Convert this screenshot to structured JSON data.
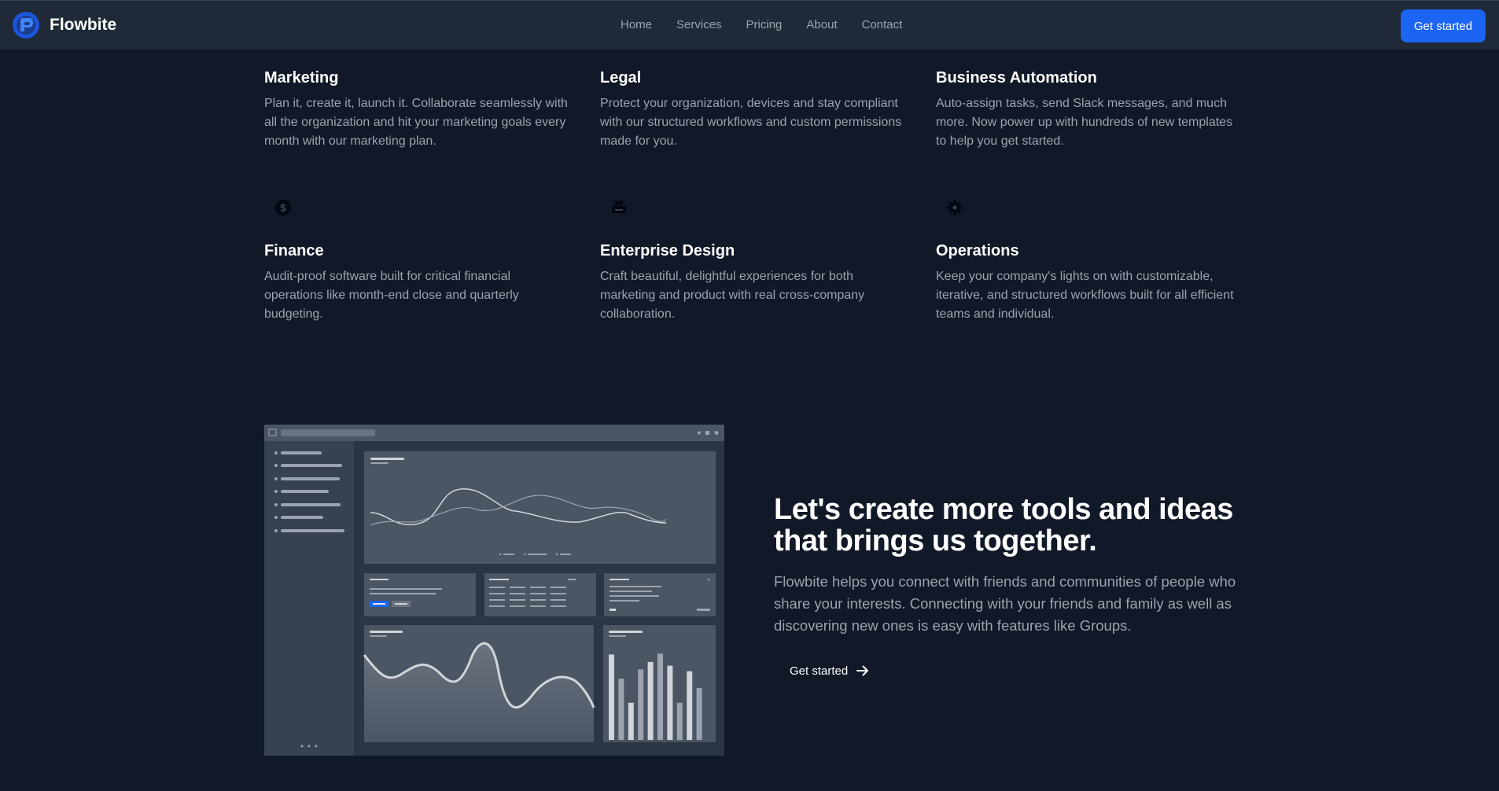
{
  "brand": {
    "name": "Flowbite",
    "logo_icon": "flowbite-logo-icon",
    "accent": "#1c64f2"
  },
  "nav": {
    "links": [
      "Home",
      "Services",
      "Pricing",
      "About",
      "Contact"
    ],
    "cta_label": "Get started"
  },
  "features": [
    {
      "title": "Marketing",
      "description": "Plan it, create it, launch it. Collaborate seamlessly with all the organization and hit your marketing goals every month with our marketing plan."
    },
    {
      "title": "Legal",
      "description": "Protect your organization, devices and stay compliant with our structured workflows and custom permissions made for you."
    },
    {
      "title": "Business Automation",
      "description": "Auto-assign tasks, send Slack messages, and much more. Now power up with hundreds of new templates to help you get started."
    },
    {
      "title": "Finance",
      "icon": "dollar-circle-icon",
      "description": "Audit-proof software built for critical financial operations like month-end close and quarterly budgeting."
    },
    {
      "title": "Enterprise Design",
      "icon": "printer-icon",
      "description": "Craft beautiful, delightful experiences for both marketing and product with real cross-company collaboration."
    },
    {
      "title": "Operations",
      "icon": "gear-icon",
      "description": "Keep your company's lights on with customizable, iterative, and structured workflows built for all efficient teams and individual."
    }
  ],
  "cta": {
    "heading": "Let's create more tools and ideas that brings us together.",
    "text": "Flowbite helps you connect with friends and communities of people who share your interests. Connecting with your friends and family as well as discovering new ones is easy with features like Groups.",
    "button_label": "Get started",
    "button_icon": "arrow-right-icon"
  },
  "dashboard_mockup": {
    "icon": "dashboard-illustration",
    "bar_values": [
      0.92,
      0.66,
      0.4,
      0.76,
      0.84,
      0.93,
      0.8,
      0.4,
      0.74,
      0.56
    ]
  }
}
